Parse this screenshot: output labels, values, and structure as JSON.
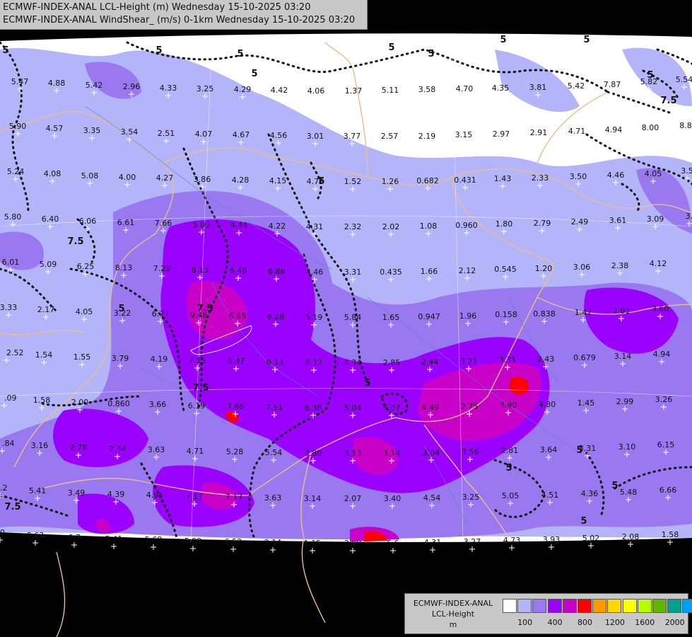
{
  "title": {
    "line1": "ECMWF-INDEX-ANAL LCL-Height (m) Wednesday 15-10-2025 03:20",
    "line2": "ECMWF-INDEX-ANAL WindShear_ (m/s) 0-1km Wednesday 15-10-2025 03:20"
  },
  "legend": {
    "title_line1": "ECMWF-INDEX-ANAL",
    "title_line2": "LCL-Height",
    "title_line3": "m",
    "colors": [
      "#ffffff",
      "#b4b4fa",
      "#9a78f0",
      "#9a00ff",
      "#c800c8",
      "#ff0000",
      "#ff9900",
      "#ffd700",
      "#ffff00",
      "#b4ff00",
      "#64b400",
      "#00a08c",
      "#00a0ff"
    ],
    "ticks": [
      "100",
      "400",
      "800",
      "1200",
      "1600",
      "2000"
    ]
  },
  "contour_labels": [
    "5",
    "5",
    "5",
    "5",
    "5",
    "7.5",
    "7.5",
    "7.5",
    "7.5",
    "5",
    "5",
    "7.5",
    "5",
    "5",
    "5",
    "5",
    "5",
    "5",
    "5",
    "5",
    "5"
  ],
  "station_values": [
    "5.47",
    "4.88",
    "5.42",
    "2.96",
    "4.33",
    "3.25",
    "4.29",
    "4.42",
    "4.06",
    "1.37",
    "5.11",
    "3.58",
    "4.70",
    "4.35",
    "3.81",
    "5.42",
    "7.87",
    "5.82",
    "5.54",
    "5.90",
    "4.57",
    "3.35",
    "3.54",
    "2.51",
    "4.07",
    "4.67",
    "4.56",
    "3.01",
    "3.77",
    "2.57",
    "2.19",
    "3.15",
    "2.97",
    "2.91",
    "4.71",
    "4.94",
    "8.00",
    "8.8",
    "5.24",
    "4.08",
    "5.08",
    "4.00",
    "4.27",
    "3.86",
    "4.28",
    "4.15",
    "4.75",
    "1.52",
    "1.26",
    "0.682",
    "0.431",
    "1.43",
    "2.33",
    "3.50",
    "4.46",
    "4.05",
    "3.5",
    "5.80",
    "6.40",
    "6.06",
    "6.61",
    "7.66",
    "5.03",
    "4.44",
    "4.22",
    "4.31",
    "2.32",
    "2.02",
    "1.08",
    "0.960",
    "1.80",
    "2.79",
    "2.49",
    "3.61",
    "3.09",
    "3.",
    "6.01",
    "5.09",
    "6.25",
    "8.13",
    "7.29",
    "8.13",
    "6.46",
    "6.86",
    "4.46",
    "3.31",
    "0.435",
    "1.66",
    "2.12",
    "0.545",
    "1.20",
    "3.06",
    "2.38",
    "4.12",
    "3.33",
    "2.17",
    "4.05",
    "3.22",
    "6.77",
    "9.46",
    "6.65",
    "6.28",
    "5.19",
    "5.84",
    "1.65",
    "0.947",
    "1.96",
    "0.158",
    "0.838",
    "1.47",
    "2.01",
    "3.60",
    "2.52",
    "1.54",
    "1.55",
    "3.79",
    "4.19",
    "7.15",
    "6.47",
    "6.13",
    "6.12",
    "4.34",
    "2.85",
    "2.44",
    "3.21",
    "3.31",
    "2.43",
    "0.679",
    "3.14",
    "4.94",
    ".09",
    "1.58",
    "2.00",
    "0.860",
    "3.66",
    "6.19",
    "7.66",
    "7.51",
    "6.38",
    "5.04",
    "5.07",
    "4.49",
    "2.75",
    "3.90",
    "4.80",
    "1.45",
    "2.99",
    "3.26",
    ".84",
    "3.16",
    "2.78",
    "2.34",
    "3.63",
    "4.71",
    "5.28",
    "5.54",
    "3.80",
    "3.13",
    "3.14",
    "3.04",
    "3.56",
    "2.81",
    "3.64",
    "3.31",
    "3.10",
    "6.15",
    ".2",
    "5.41",
    "3.49",
    "4.39",
    "4.95",
    "7.17",
    "7.17",
    "3.63",
    "3.14",
    "2.07",
    "3.40",
    "4.54",
    "3.25",
    "5.05",
    "4.51",
    "4.36",
    "5.48",
    "6.66",
    "0",
    "8.63",
    "6.7",
    "5.41",
    "5.68",
    "5.99",
    "6.52",
    "2.14",
    "1.15",
    "3.08",
    "5.6",
    "4.31",
    "3.27",
    "4.73",
    "3.93",
    "5.02",
    "2.08",
    "1.58"
  ]
}
